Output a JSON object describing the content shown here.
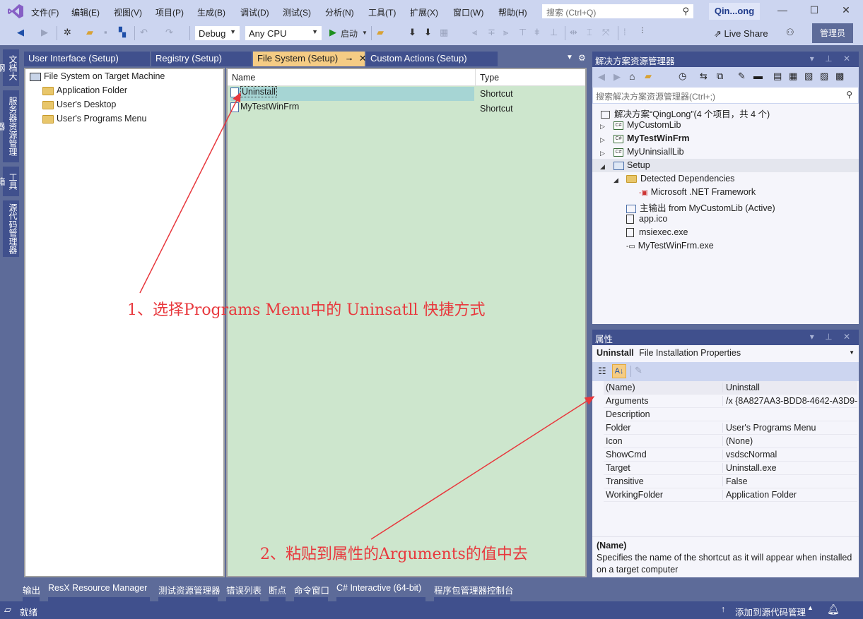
{
  "title_bar": {
    "menus": [
      "文件(F)",
      "编辑(E)",
      "视图(V)",
      "项目(P)",
      "生成(B)",
      "调试(D)",
      "测试(S)",
      "分析(N)",
      "工具(T)",
      "扩展(X)",
      "窗口(W)",
      "帮助(H)"
    ],
    "search_placeholder": "搜索 (Ctrl+Q)",
    "solution_name": "Qin...ong",
    "window_controls": {
      "minimize": "—",
      "maximize": "☐",
      "close": "✕"
    }
  },
  "toolbar": {
    "config": "Debug",
    "platform": "Any CPU",
    "start_label": "启动",
    "live_share": "Live Share",
    "admin_badge": "管理员"
  },
  "left_strip": [
    "文档大纲",
    "服务器资源管理器",
    "工具箱",
    "源代码管理器"
  ],
  "doc_tabs": [
    {
      "label": "User Interface (Setup)",
      "active": false
    },
    {
      "label": "Registry (Setup)",
      "active": false
    },
    {
      "label": "File System (Setup)",
      "active": true
    },
    {
      "label": "Custom Actions (Setup)",
      "active": false
    }
  ],
  "fs_tree": {
    "root": "File System on Target Machine",
    "children": [
      "Application Folder",
      "User's Desktop",
      "User's Programs Menu"
    ]
  },
  "fs_list": {
    "columns": [
      "Name",
      "Type"
    ],
    "rows": [
      {
        "name": "Uninstall",
        "type": "Shortcut",
        "selected": true
      },
      {
        "name": "MyTestWinFrm",
        "type": "Shortcut",
        "selected": false
      }
    ]
  },
  "annotations": {
    "step1": "1、选择Programs Menu中的 Uninsatll 快捷方式",
    "step2": "2、粘贴到属性的Arguments的值中去",
    "color": "#e8383d"
  },
  "solution_explorer": {
    "title": "解决方案资源管理器",
    "search_placeholder": "搜索解决方案资源管理器(Ctrl+;)",
    "solution": "解决方案“QingLong”(4 个项目，共 4 个)",
    "projects": [
      {
        "name": "MyCustomLib",
        "bold": false
      },
      {
        "name": "MyTestWinFrm",
        "bold": true
      },
      {
        "name": "MyUninsiallLib",
        "bold": false
      }
    ],
    "setup": {
      "name": "Setup",
      "detected_dependencies": "Detected Dependencies",
      "framework": "Microsoft .NET Framework",
      "items": [
        "主输出 from MyCustomLib (Active)",
        "app.ico",
        "msiexec.exe",
        "MyTestWinFrm.exe"
      ]
    }
  },
  "properties": {
    "title": "属性",
    "object_name": "Uninstall",
    "object_type": "File Installation Properties",
    "rows": [
      {
        "key": "(Name)",
        "value": "Uninstall"
      },
      {
        "key": "Arguments",
        "value": "/x {8A827AA3-BDD8-4642-A3D9-"
      },
      {
        "key": "Description",
        "value": ""
      },
      {
        "key": "Folder",
        "value": "User's Programs Menu"
      },
      {
        "key": "Icon",
        "value": "(None)"
      },
      {
        "key": "ShowCmd",
        "value": "vsdscNormal"
      },
      {
        "key": "Target",
        "value": "Uninstall.exe"
      },
      {
        "key": "Transitive",
        "value": "False"
      },
      {
        "key": "WorkingFolder",
        "value": "Application Folder"
      }
    ],
    "desc_title": "(Name)",
    "desc_text": "Specifies the name of the shortcut as it will appear when installed on a target computer"
  },
  "bottom_tabs": [
    "输出",
    "ResX Resource Manager",
    "测试资源管理器",
    "错误列表",
    "断点",
    "命令窗口",
    "C# Interactive (64-bit)",
    "程序包管理器控制台"
  ],
  "status_bar": {
    "ready": "就绪",
    "source_control": "添加到源代码管理"
  }
}
